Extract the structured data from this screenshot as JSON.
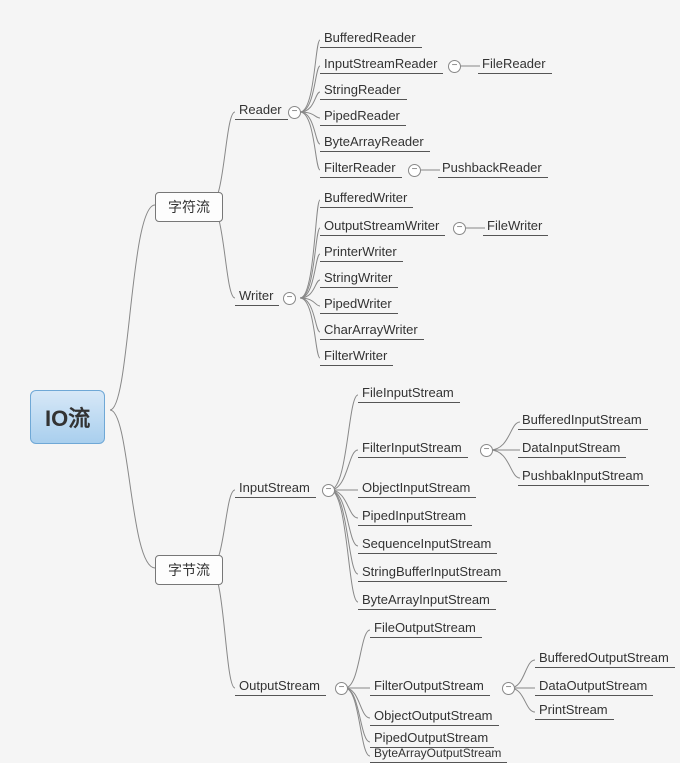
{
  "root": "IO流",
  "charStream": {
    "label": "字符流",
    "reader": {
      "label": "Reader",
      "children": [
        "BufferedReader",
        "InputStreamReader",
        "StringReader",
        "PipedReader",
        "ByteArrayReader",
        "FilterReader"
      ],
      "inputStreamReaderChild": "FileReader",
      "filterReaderChild": "PushbackReader"
    },
    "writer": {
      "label": "Writer",
      "children": [
        "BufferedWriter",
        "OutputStreamWriter",
        "PrinterWriter",
        "StringWriter",
        "PipedWriter",
        "CharArrayWriter",
        "FilterWriter"
      ],
      "outputStreamWriterChild": "FileWriter"
    }
  },
  "byteStream": {
    "label": "字节流",
    "input": {
      "label": "InputStream",
      "children": [
        "FileInputStream",
        "FilterInputStream",
        "ObjectInputStream",
        "PipedInputStream",
        "SequenceInputStream",
        "StringBufferInputStream",
        "ByteArrayInputStream"
      ],
      "filterChildren": [
        "BufferedInputStream",
        "DataInputStream",
        "PushbakInputStream"
      ]
    },
    "output": {
      "label": "OutputStream",
      "children": [
        "FileOutputStream",
        "FilterOutputStream",
        "ObjectOutputStream",
        "PipedOutputStream",
        "ByteArrayOutputStream"
      ],
      "filterChildren": [
        "BufferedOutputStream",
        "DataOutputStream",
        "PrintStream"
      ]
    }
  },
  "collapseGlyph": "−"
}
